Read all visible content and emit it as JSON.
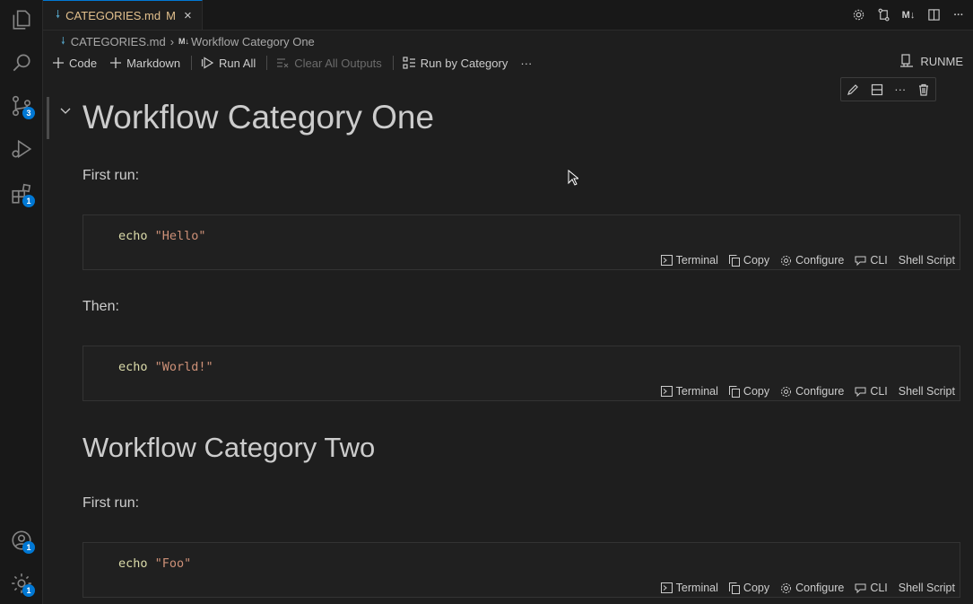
{
  "activity_bar": {
    "items": [
      {
        "name": "explorer-icon"
      },
      {
        "name": "search-icon"
      },
      {
        "name": "source-control-icon",
        "badge": "3"
      },
      {
        "name": "run-debug-icon"
      },
      {
        "name": "extensions-icon",
        "badge": "1"
      }
    ],
    "bottom": [
      {
        "name": "accounts-icon",
        "badge": "1"
      },
      {
        "name": "manage-gear-icon",
        "badge": "1"
      }
    ]
  },
  "tab": {
    "label": "CATEGORIES.md",
    "modified": "M",
    "close": "×"
  },
  "editor_actions": {
    "markdown_label": "M↓",
    "more": "···"
  },
  "breadcrumb": {
    "file": "CATEGORIES.md",
    "md_icon": "M↓",
    "heading": "Workflow Category One"
  },
  "toolbar": {
    "code": "Code",
    "markdown": "Markdown",
    "run_all": "Run All",
    "clear_outputs": "Clear All Outputs",
    "run_by_category": "Run by Category",
    "more": "···"
  },
  "kernel": {
    "label": "RUNME"
  },
  "cell_toolbar": {
    "more": "···"
  },
  "content": {
    "heading1": "Workflow Category One",
    "para1": "First run:",
    "para2": "Then:",
    "heading2": "Workflow Category Two",
    "para3": "First run:"
  },
  "cells": [
    {
      "cmd": "echo",
      "arg": "\"Hello\""
    },
    {
      "cmd": "echo",
      "arg": "\"World!\""
    },
    {
      "cmd": "echo",
      "arg": "\"Foo\""
    }
  ],
  "cell_status": {
    "terminal": "Terminal",
    "copy": "Copy",
    "configure": "Configure",
    "cli": "CLI",
    "language": "Shell Script"
  },
  "colors": {
    "accent": "#0078d4",
    "tab_modified": "#e2c08d",
    "string": "#ce9178",
    "keyword": "#dcdcaa"
  }
}
